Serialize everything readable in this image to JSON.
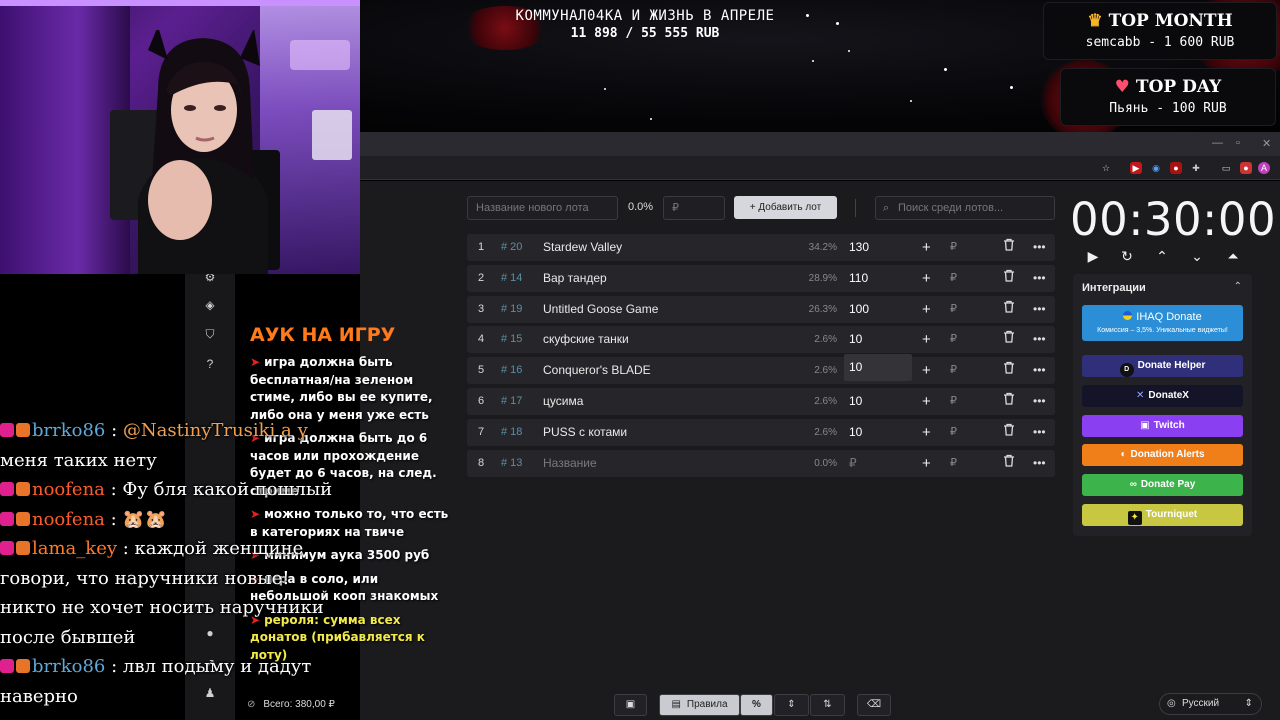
{
  "banner": {
    "goal_title": "КОММУНАЛ04КА И ЖИЗНЬ В АПРЕЛЕ",
    "goal_progress": "11 898 / 55 555 RUB",
    "top_month_title": "TOP MONTH",
    "top_month_value": "semcabb - 1 600 RUB",
    "top_day_title": "TOP DAY",
    "top_day_value": "Пьянь - 100 RUB"
  },
  "toolbar": {
    "new_lot_placeholder": "Название нового лота",
    "percent": "0.0%",
    "amount_placeholder": "₽",
    "add_button": "+ Добавить лот",
    "search_placeholder": "Поиск среди лотов..."
  },
  "lots": [
    {
      "num": "1",
      "id": "# 20",
      "name": "Stardew Valley",
      "pct": "34.2%",
      "amount": "130"
    },
    {
      "num": "2",
      "id": "# 14",
      "name": "Вар тандер",
      "pct": "28.9%",
      "amount": "110"
    },
    {
      "num": "3",
      "id": "# 19",
      "name": "Untitled Goose Game",
      "pct": "26.3%",
      "amount": "100"
    },
    {
      "num": "4",
      "id": "# 15",
      "name": "скуфские танки",
      "pct": "2.6%",
      "amount": "10"
    },
    {
      "num": "5",
      "id": "# 16",
      "name": "Conqueror's BLADE",
      "pct": "2.6%",
      "amount": "10"
    },
    {
      "num": "6",
      "id": "# 17",
      "name": "цусима",
      "pct": "2.6%",
      "amount": "10"
    },
    {
      "num": "7",
      "id": "# 18",
      "name": "PUSS с котами",
      "pct": "2.6%",
      "amount": "10"
    },
    {
      "num": "8",
      "id": "# 13",
      "name": "Название",
      "pct": "0.0%",
      "amount": "₽"
    }
  ],
  "currency": "₽",
  "timer": "00:30:00",
  "integrations": {
    "title": "Интеграции",
    "ihaq_title": "IHAQ Donate",
    "ihaq_sub": "Комиссия – 3,5%. Уникальные виджеты!",
    "items": [
      "Donate Helper",
      "DonateX",
      "Twitch",
      "Donation Alerts",
      "Donate Pay",
      "Tourniquet"
    ]
  },
  "rules": {
    "heading": "АУК НА ИГРУ",
    "items": [
      "игра должна быть бесплатная/на зеленом стиме, либо вы ее купите, либо она у меня уже есть",
      "игра должна быть до 6 часов или прохождение будет до 6 часов, на след. стриме",
      "можно только то, что есть в категориях на твиче",
      "минимум аука 3500 руб",
      "игра в соло, или небольшой кооп знакомых",
      "рероля: сумма всех донатов (прибавляется к лоту)"
    ]
  },
  "bottom": {
    "total": "Всего: 380,00 ₽",
    "rules_button": "Правила",
    "percent_button": "%",
    "language": "Русский"
  },
  "chat": [
    {
      "nick": "brrko86",
      "text": "@NastinyTrusiki а у"
    },
    {
      "nick": "",
      "text": "меня таких нету"
    },
    {
      "nick": "noofena",
      "text": "Фу бля какой пошлый"
    },
    {
      "nick": "noofena",
      "text": ""
    },
    {
      "nick": "lama_key",
      "text": "каждой женщине"
    },
    {
      "nick": "",
      "text": "говори, что наручники новые!"
    },
    {
      "nick": "",
      "text": "никто не хочет носить наручники"
    },
    {
      "nick": "",
      "text": "после бывшей"
    },
    {
      "nick": "brrko86",
      "text": "лвл подыму и дадут"
    },
    {
      "nick": "",
      "text": "наверно"
    }
  ],
  "colors": {
    "accent_orange": "#ff7a1a",
    "ihaq": "#2b8ed6",
    "donate_helper": "#2f2f7a",
    "donatex": "#141428",
    "twitch": "#8a3ff0",
    "donation_alerts": "#f07f1a",
    "donate_pay": "#3cb44b",
    "tourniquet": "#c7c742"
  }
}
